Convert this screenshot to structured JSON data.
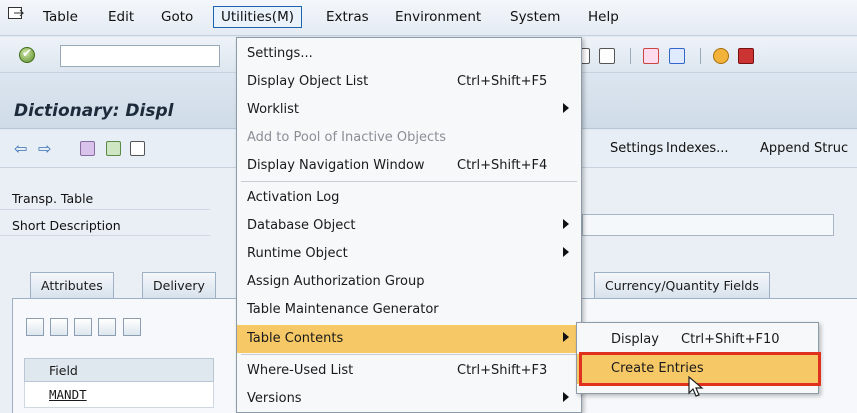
{
  "menubar": {
    "items": [
      "Table",
      "Edit",
      "Goto",
      "Utilities(M)",
      "Extras",
      "Environment",
      "System",
      "Help"
    ],
    "active_index": 3
  },
  "title": "Dictionary: Displ",
  "app_toolbar": {
    "buttons": [
      "Settings",
      "Indexes...",
      "Append Struc"
    ]
  },
  "fields": {
    "transp_table_label": "Transp. Table",
    "short_description_label": "Short Description"
  },
  "tabs": [
    "Attributes",
    "Delivery",
    "Currency/Quantity Fields"
  ],
  "grid": {
    "header": "Field",
    "rows": [
      "MANDT"
    ]
  },
  "utilities_menu": {
    "items": [
      {
        "label": "Settings...",
        "shortcut": "",
        "submenu": false,
        "disabled": false
      },
      {
        "label": "Display Object List",
        "shortcut": "Ctrl+Shift+F5",
        "submenu": false,
        "disabled": false
      },
      {
        "label": "Worklist",
        "shortcut": "",
        "submenu": true,
        "disabled": false
      },
      {
        "label": "Add to Pool of Inactive Objects",
        "shortcut": "",
        "submenu": false,
        "disabled": true
      },
      {
        "label": "Display Navigation Window",
        "shortcut": "Ctrl+Shift+F4",
        "submenu": false,
        "disabled": false
      },
      {
        "label": "Activation Log",
        "shortcut": "",
        "submenu": false,
        "disabled": false
      },
      {
        "label": "Database Object",
        "shortcut": "",
        "submenu": true,
        "disabled": false
      },
      {
        "label": "Runtime Object",
        "shortcut": "",
        "submenu": true,
        "disabled": false
      },
      {
        "label": "Assign Authorization Group",
        "shortcut": "",
        "submenu": false,
        "disabled": false
      },
      {
        "label": "Table Maintenance Generator",
        "shortcut": "",
        "submenu": false,
        "disabled": false
      },
      {
        "label": "Table Contents",
        "shortcut": "",
        "submenu": true,
        "disabled": false
      },
      {
        "label": "Where-Used List",
        "shortcut": "Ctrl+Shift+F3",
        "submenu": false,
        "disabled": false
      },
      {
        "label": "Versions",
        "shortcut": "",
        "submenu": true,
        "disabled": false
      }
    ],
    "highlighted_index": 10
  },
  "table_contents_submenu": {
    "items": [
      {
        "label": "Display",
        "shortcut": "Ctrl+Shift+F10"
      },
      {
        "label": "Create Entries",
        "shortcut": ""
      }
    ],
    "highlighted_index": 1
  },
  "colors": {
    "menu_highlight": "#f6c866",
    "annotation_box": "#e0301e",
    "active_menu_border": "#1d64b0"
  }
}
